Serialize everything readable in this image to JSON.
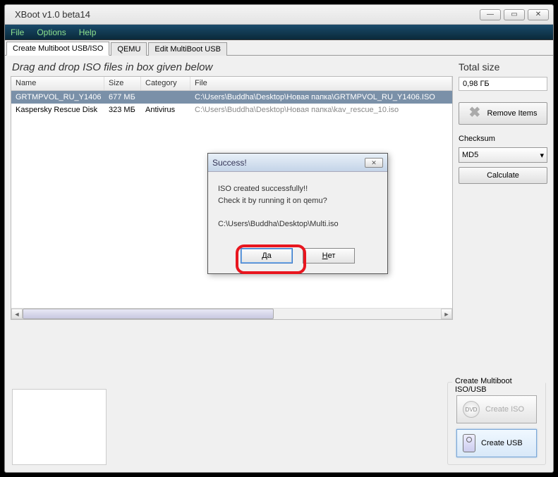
{
  "window": {
    "title": "XBoot v1.0 beta14"
  },
  "menu": {
    "file": "File",
    "options": "Options",
    "help": "Help"
  },
  "tabs": {
    "create": "Create Multiboot USB/ISO",
    "qemu": "QEMU",
    "edit": "Edit MultiBoot USB"
  },
  "main": {
    "drag_label": "Drag and drop ISO files in box given below",
    "headers": {
      "name": "Name",
      "size": "Size",
      "category": "Category",
      "file": "File"
    },
    "rows": [
      {
        "name": "GRTMPVOL_RU_Y1406",
        "size": "677 МБ",
        "category": "",
        "file": "C:\\Users\\Buddha\\Desktop\\Новая папка\\GRTMPVOL_RU_Y1406.ISO"
      },
      {
        "name": "Kaspersky Rescue Disk",
        "size": "323 МБ",
        "category": "Antivirus",
        "file": "C:\\Users\\Buddha\\Desktop\\Новая папка\\kav_rescue_10.iso"
      }
    ]
  },
  "side": {
    "total_label": "Total size",
    "total_value": "0,98 ГБ",
    "remove": "Remove Items",
    "checksum_label": "Checksum",
    "checksum_value": "MD5",
    "calculate": "Calculate"
  },
  "bottom": {
    "group_label": "Create Multiboot ISO/USB",
    "create_iso": "Create ISO",
    "create_usb": "Create USB",
    "dvd": "DVD"
  },
  "dialog": {
    "title": "Success!",
    "line1": "ISO created successfully!!",
    "line2": "Check it by running it on qemu?",
    "path": "C:\\Users\\Buddha\\Desktop\\Multi.iso",
    "yes_underline": "Д",
    "yes_rest": "а",
    "no_underline": "Н",
    "no_rest": "ет"
  }
}
